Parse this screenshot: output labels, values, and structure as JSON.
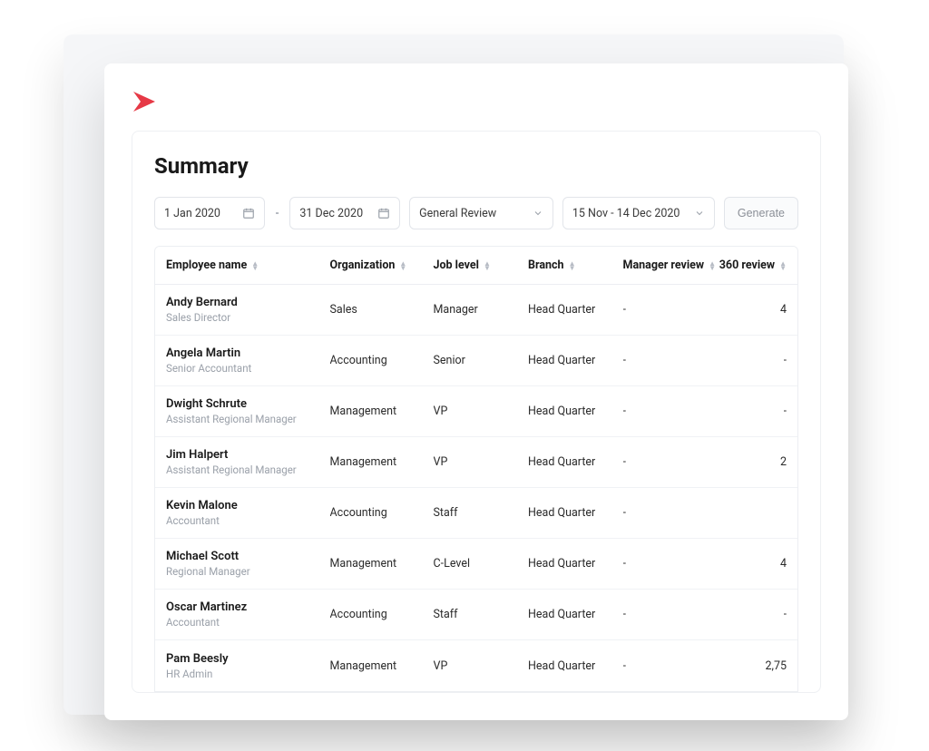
{
  "page": {
    "title": "Summary"
  },
  "logo": {
    "color": "#e63946"
  },
  "filters": {
    "start_date": "1 Jan 2020",
    "end_date": "31 Dec 2020",
    "review_type": "General Review",
    "period": "15 Nov - 14 Dec 2020",
    "generate_label": "Generate"
  },
  "table": {
    "columns": [
      "Employee name",
      "Organization",
      "Job level",
      "Branch",
      "Manager review",
      "360 review"
    ],
    "rows": [
      {
        "name": "Andy Bernard",
        "role": "Sales Director",
        "org": "Sales",
        "level": "Manager",
        "branch": "Head Quarter",
        "mgr": "-",
        "r360": "4"
      },
      {
        "name": "Angela Martin",
        "role": "Senior Accountant",
        "org": "Accounting",
        "level": "Senior",
        "branch": "Head Quarter",
        "mgr": "-",
        "r360": "-"
      },
      {
        "name": "Dwight Schrute",
        "role": "Assistant Regional Manager",
        "org": "Management",
        "level": "VP",
        "branch": "Head Quarter",
        "mgr": "-",
        "r360": "-"
      },
      {
        "name": "Jim Halpert",
        "role": "Assistant Regional Manager",
        "org": "Management",
        "level": "VP",
        "branch": "Head Quarter",
        "mgr": "-",
        "r360": "2"
      },
      {
        "name": "Kevin Malone",
        "role": "Accountant",
        "org": "Accounting",
        "level": "Staff",
        "branch": "Head Quarter",
        "mgr": "-",
        "r360": ""
      },
      {
        "name": "Michael Scott",
        "role": "Regional Manager",
        "org": "Management",
        "level": "C-Level",
        "branch": "Head Quarter",
        "mgr": "-",
        "r360": "4"
      },
      {
        "name": "Oscar Martinez",
        "role": "Accountant",
        "org": "Accounting",
        "level": "Staff",
        "branch": "Head Quarter",
        "mgr": "-",
        "r360": "-"
      },
      {
        "name": "Pam Beesly",
        "role": "HR Admin",
        "org": "Management",
        "level": "VP",
        "branch": "Head Quarter",
        "mgr": "-",
        "r360": "2,75"
      }
    ]
  }
}
